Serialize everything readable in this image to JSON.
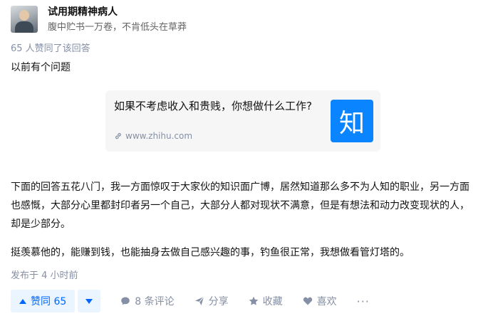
{
  "author": {
    "name": "试用期精神病人",
    "headline": "腹中贮书一万卷，不肯低头在草莽"
  },
  "vote_info": "65 人赞同了该回答",
  "paragraphs": {
    "p1": "以前有个问题",
    "p2": "下面的回答五花八门，我一方面惊叹于大家伙的知识面广博，居然知道那么多不为人知的职业，另一方面也感慨，大部分心里都封印者另一个自己，大部分人都对现状不满意，但是有想法和动力改变现状的人，却是少部分。",
    "p3": "挺羡慕他的，能赚到钱，也能抽身去做自己感兴趣的事，钓鱼很正常，我想做看管灯塔的。"
  },
  "link_card": {
    "title": "如果不考虑收入和贵贱，你想做什么工作?",
    "url": "www.zhihu.com",
    "logo_text": "知"
  },
  "time": "发布于 4 小时前",
  "actions": {
    "vote_up": "赞同 65",
    "comments": "8 条评论",
    "share": "分享",
    "collect": "收藏",
    "like": "喜欢",
    "more": "···"
  },
  "colors": {
    "accent": "#0066ff",
    "accent_bg": "#ebf5ff",
    "muted": "#8590a6",
    "logo_bg": "#0a84ff"
  }
}
